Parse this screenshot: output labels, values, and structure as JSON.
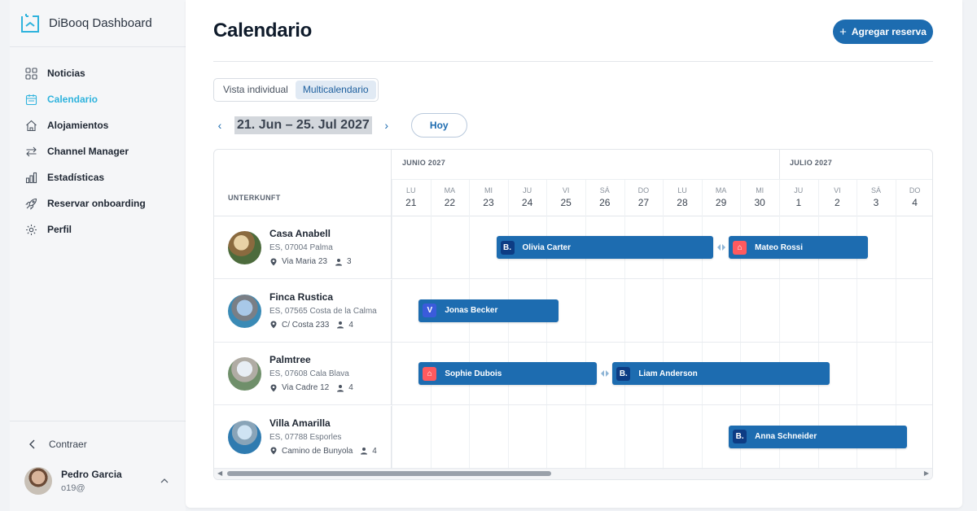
{
  "app": {
    "name": "DiBooq Dashboard"
  },
  "nav": [
    {
      "label": "Noticias",
      "icon": "grid-icon",
      "active": false
    },
    {
      "label": "Calendario",
      "icon": "calendar-icon",
      "active": true
    },
    {
      "label": "Alojamientos",
      "icon": "home-icon",
      "active": false
    },
    {
      "label": "Channel Manager",
      "icon": "swap-arrows-icon",
      "active": false
    },
    {
      "label": "Estadísticas",
      "icon": "bar-chart-icon",
      "active": false
    },
    {
      "label": "Reservar onboarding",
      "icon": "rocket-icon",
      "active": false
    },
    {
      "label": "Perfil",
      "icon": "gear-icon",
      "active": false
    }
  ],
  "sidebar": {
    "collapse_label": "Contraer"
  },
  "user": {
    "name": "Pedro Garcia",
    "sub": "o19@"
  },
  "page": {
    "title": "Calendario",
    "add_button": "Agregar reserva"
  },
  "view_toggle": {
    "options": [
      "Vista individual",
      "Multicalendario"
    ],
    "selected": "Multicalendario"
  },
  "range": {
    "label": "21. Jun – 25. Jul 2027",
    "today_label": "Hoy"
  },
  "calendar": {
    "column_header": "UNTERKUNFT",
    "months": [
      {
        "label": "JUNIO 2027",
        "start_index": 0
      },
      {
        "label": "JULIO 2027",
        "start_index": 10
      }
    ],
    "days": [
      {
        "name": "LU",
        "num": "21"
      },
      {
        "name": "MA",
        "num": "22"
      },
      {
        "name": "MI",
        "num": "23"
      },
      {
        "name": "JU",
        "num": "24"
      },
      {
        "name": "VI",
        "num": "25"
      },
      {
        "name": "SÁ",
        "num": "26"
      },
      {
        "name": "DO",
        "num": "27"
      },
      {
        "name": "LU",
        "num": "28"
      },
      {
        "name": "MA",
        "num": "29"
      },
      {
        "name": "MI",
        "num": "30"
      },
      {
        "name": "JU",
        "num": "1"
      },
      {
        "name": "VI",
        "num": "2"
      },
      {
        "name": "SÁ",
        "num": "3"
      },
      {
        "name": "DO",
        "num": "4"
      }
    ],
    "properties": [
      {
        "name": "Casa Anabell",
        "location": "ES, 07004 Palma",
        "address": "Via Maria 23",
        "guests": "3"
      },
      {
        "name": "Finca Rustica",
        "location": "ES, 07565 Costa de la Calma",
        "address": "C/ Costa 233",
        "guests": "4"
      },
      {
        "name": "Palmtree",
        "location": "ES, 07608 Cala Blava",
        "address": "Via Cadre 12",
        "guests": "4"
      },
      {
        "name": "Villa Amarilla",
        "location": "ES, 07788 Esporles",
        "address": "Camino de Bunyola",
        "guests": "4"
      }
    ],
    "bookings": [
      {
        "guest": "Olivia Carter",
        "channel": "booking",
        "row": 0,
        "start_day": 2.7,
        "end_day": 8.3
      },
      {
        "guest": "Mateo Rossi",
        "channel": "airbnb",
        "row": 0,
        "start_day": 8.7,
        "end_day": 12.3
      },
      {
        "guest": "Jonas Becker",
        "channel": "vrbo",
        "row": 1,
        "start_day": 0.7,
        "end_day": 4.3
      },
      {
        "guest": "Sophie Dubois",
        "channel": "airbnb",
        "row": 2,
        "start_day": 0.7,
        "end_day": 5.3
      },
      {
        "guest": "Liam Anderson",
        "channel": "booking",
        "row": 2,
        "start_day": 5.7,
        "end_day": 11.3
      },
      {
        "guest": "Anna Schneider",
        "channel": "booking",
        "row": 3,
        "start_day": 8.7,
        "end_day": 13.3
      }
    ],
    "links": [
      {
        "row": 0,
        "day": 8.5
      },
      {
        "row": 2,
        "day": 5.5
      }
    ]
  },
  "colors": {
    "accent": "#2fb3dd",
    "primary": "#1d6cb0",
    "booking_badge": "#0d3c84",
    "airbnb_badge": "#ff5a5f",
    "vrbo_badge": "#3b5bdb"
  }
}
